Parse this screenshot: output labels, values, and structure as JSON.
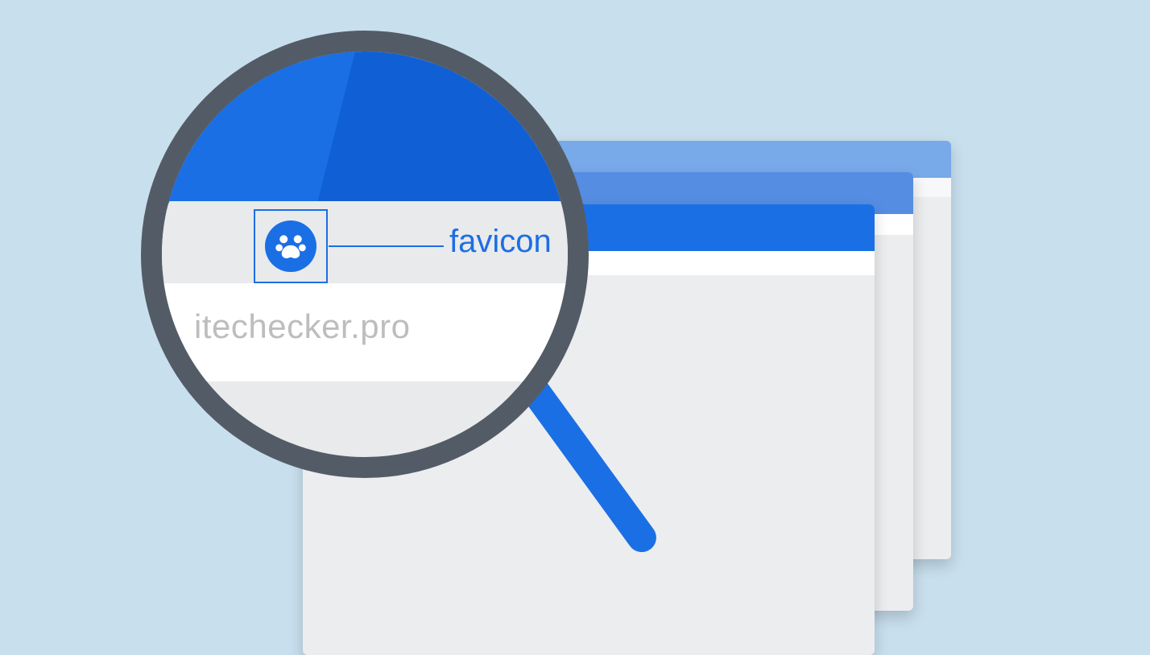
{
  "callout_label": "favicon",
  "url_fragment": "itechecker.pro",
  "favicon_name": "paw-icon",
  "colors": {
    "background": "#c8dfee",
    "primary_blue": "#1b6fe4",
    "lens_ring": "#535c66",
    "muted_text": "#bdbdbd"
  }
}
